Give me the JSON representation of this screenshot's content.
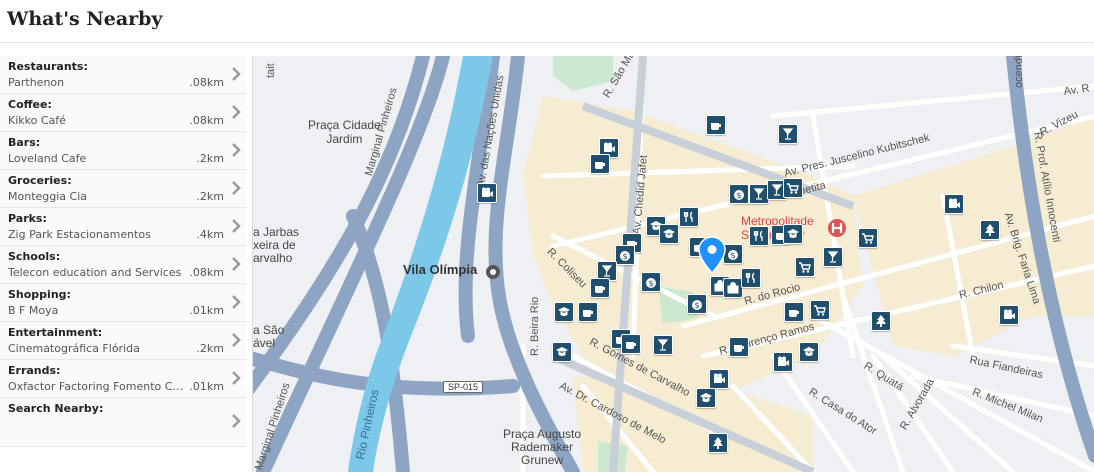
{
  "page": {
    "title": "What's Nearby"
  },
  "categories": [
    {
      "label": "Restaurants:",
      "place": "Parthenon",
      "distance": ".08km"
    },
    {
      "label": "Coffee:",
      "place": "Kikko Café",
      "distance": ".08km"
    },
    {
      "label": "Bars:",
      "place": "Loveland Cafe",
      "distance": ".2km"
    },
    {
      "label": "Groceries:",
      "place": "Monteggia Cia",
      "distance": ".2km"
    },
    {
      "label": "Parks:",
      "place": "Zig Park Estacionamentos",
      "distance": ".4km"
    },
    {
      "label": "Schools:",
      "place": "Telecon education and Services",
      "distance": ".08km"
    },
    {
      "label": "Shopping:",
      "place": "B F Moya",
      "distance": ".01km"
    },
    {
      "label": "Entertainment:",
      "place": "Cinematográfica Flórida",
      "distance": ".2km"
    },
    {
      "label": "Errands:",
      "place": "Oxfactor Factoring Fomento Co...",
      "distance": ".01km"
    }
  ],
  "search_nearby": {
    "label": "Search Nearby:"
  },
  "map": {
    "labels": {
      "praca_cidade_jardim": "Praça Cidade\nJardim",
      "vila_olimpia": "Vila Olímpia",
      "marginal_pinheiros": "Marginal Pinheiros",
      "marginal_pinheiros_2": "Marginal Pinheiros",
      "av_nacoes_unidas": "Av. das Nações Unidas",
      "rio_pinheiros": "Rio Pinheiros",
      "av_pres_jk": "Av. Pres. Juscelino Kubitschek",
      "av_chedid_jafet": "Av. Chedid Jafet",
      "r_coliseu": "R. Coliseu",
      "r_beira_rio": "R. Beira Rio",
      "r_do_rocio": "R. do Rocio",
      "r_gomes_de_carvalho": "R. Gomes de Carvalho",
      "av_dr_cardoso_de_melo": "Av. Dr. Cardoso de Melo",
      "r_lencio_ramos": "R. Lourenço Ramos",
      "r_chilon": "R. Chilon",
      "r_quata": "R. Quatá",
      "r_casa_do_ator": "R. Casa do Ator",
      "r_alvorada": "R. Alvorada",
      "r_michel_milan": "R. Michel Milan",
      "rua_fiandeiras": "Rua Fiandeiras",
      "r_vizeu": "R. Vizeu",
      "r_prof_atilio": "R. Prof. Atílio Innocenti",
      "av_brig_faria_lima": "Av. Brig. Faria Lima",
      "praca_augusto": "Praça Augusto\nRademaker\nGrunew",
      "hospital": "Metropolitade\nSanta Catar",
      "sp015": "SP-015",
      "jarbas": "a Jarbas\nxeira de\narvalho",
      "r_sao": "R. São Ma",
      "tait": "tait",
      "cendi": "ocendi",
      "av": "Av. R",
      "asao": "a São\nável",
      "uetita": "uetita"
    },
    "colors": {
      "poi": "#1f4f6d",
      "pin": "#1e90ff",
      "river": "#7cc8e8",
      "highway": "#8ea4c3",
      "commercial": "#f6ecd2",
      "park": "#cde8d0"
    }
  }
}
